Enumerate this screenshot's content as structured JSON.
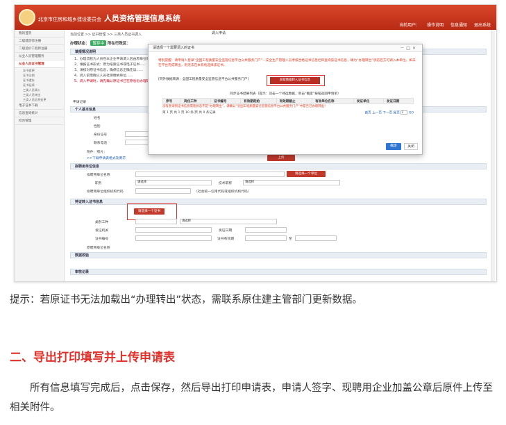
{
  "app": {
    "title": "人员资格管理信息系统",
    "title_prefix": "北京市住房和城乡建设委员会",
    "user_label": "当前用户：",
    "help": "操作说明",
    "messages": "信息通知",
    "logout": "退出系统"
  },
  "nav": {
    "items": [
      {
        "label": "我的首页"
      },
      {
        "label": "二级建造师注册"
      },
      {
        "label": "二级造价工程师注册"
      },
      {
        "label": "从业人员管理服务"
      },
      {
        "label": "从业人员证书管理",
        "active": true
      },
      {
        "label": "电子证书下载"
      },
      {
        "label": "信息查询统计"
      },
      {
        "label": "综合管理"
      }
    ],
    "subs": [
      "证书变更",
      "证书注销",
      "证书遗失",
      "证书延续",
      "三类人员调入",
      "三类人员转出",
      "三类人员信息变更"
    ]
  },
  "main": {
    "crumb": "当前位置 >> 证书管理 >> 三类人员证书调入",
    "tab": "调入申请",
    "status_label": "办理状态：",
    "status_value": "暂存中",
    "status_extra": "所在行政区：",
    "notes_title": "填报情况说明",
    "notes": [
      "1、办理流程为人员在本企业申请调入后由原单位审核……",
      "2、填报证书形式：原为纸质证书或电子证书……",
      "3、请核对原证书信息，确保信息正确无误……",
      "4、调入前需确认人员社保缴纳单位……"
    ],
    "notes_red": "5、调入申请时，请先确认原证书已在原省份办理转出",
    "apply_title": "申请记录",
    "person_section": "个人基本信息",
    "name_label": "姓名",
    "gender_label": "性别",
    "id_label": "身份证号",
    "phone_label": "联系电话",
    "attachment_label": "附件：照片：",
    "photo_hint": "（格式要求：一寸正面免冠照片）",
    "download_link": ">>下载申请表格式及要求",
    "upload_button": "上传",
    "hire_section": "拟聘用单位信息",
    "company_label": "拟聘用单位名称",
    "select_company_button": "请选择一个单位",
    "position_label": "职务",
    "please_select": "请选择",
    "title_label": "技术职称",
    "org_code_label": "拟聘用单位组织机构代码",
    "org_code_hint": "（社会统一信用代码或组织机构代码）",
    "cert_section": "持证转入证书信息",
    "select_cert_button": "请选择一个证书",
    "category_label": "类别工种",
    "issuer_label": "发证机关",
    "issue_date_label": "发证日期",
    "cert_no_label": "证书编号",
    "valid_label": "证书有效期",
    "valid_to": "至",
    "orig_company_label": "原聘用单位名称",
    "data_check": "数据校验",
    "records": "审核记录"
  },
  "modal": {
    "title": "请选择一个需要调入的证书",
    "warn": "特别提醒：请申请人登录“全国工程质量安全监管信息平台公共服务门户”—安全生产管理人员考核合格证书信息栏目查询该证书信息，填为“办理转出”状态后方可调入本单位，如未在平台完成转出，则无法在本系统选择该证书。",
    "source_label": "[同外数据来源：全国工程质量安全监管信息平台公共服务门户]",
    "fetch_button": "获取数据转入证书信息",
    "hint": "同步证书结果列表（提示：双击一个待选数据，单击“确定”按钮返回申请单）",
    "columns": [
      "序号",
      "岗位工种",
      "证书编号",
      "有效期起始",
      "有效期截止",
      "有效单位名称",
      "发证单位",
      "发证日期"
    ],
    "empty": "没有查询到证书信息或者状态不是“办理转出”，请确认“全国工程质量安全监管信息平台公共服务门户”中是否已办理转出！",
    "pager": "第 1 页 共 1 页 10 条/页 共 0 条记录",
    "pager_nav": "首页 上一页 下一页 尾页",
    "page_input": "1",
    "go": "GO",
    "ok": "确定",
    "cancel": "关闭"
  },
  "article": {
    "caption": "提示：若原证书无法加载出“办理转出”状态，需联系原住建主管部门更新数据。",
    "heading": "二、导出打印填写并上传申请表",
    "paragraph": "所有信息填写完成后，点击保存，然后导出打印申请表，申请人签字、现聘用企业加盖公章后原件上传至相关附件。"
  }
}
